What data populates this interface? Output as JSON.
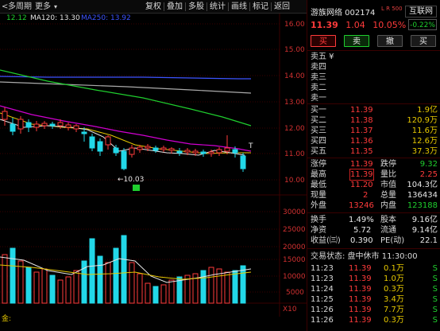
{
  "toolbar": {
    "left_items": [
      "多周期",
      "更多"
    ],
    "right_items": [
      "复权",
      "叠加",
      "多股",
      "统计",
      "画线",
      "标记",
      "返回"
    ]
  },
  "ma_legend": [
    {
      "text": "12.12",
      "color": "#e6e6e6"
    },
    {
      "text": "MA120: 13.30",
      "color": "#e6e6e6"
    },
    {
      "text": "MA250: 13.92",
      "color": "#3c54ff"
    }
  ],
  "chart": {
    "price_axis": [
      "16.00",
      "15.00",
      "14.00",
      "13.00",
      "12.00",
      "11.00",
      "10.00"
    ],
    "volume_axis": [
      "30000",
      "25000",
      "20000",
      "15000",
      "10000",
      "5000"
    ],
    "volume_unit": "X10",
    "min_marker": "←10.03",
    "fund_label": "金:",
    "colors": {
      "up": "#ff3b3b",
      "down": "#22d8e8",
      "ma5": "#e6e6e6",
      "ma10": "#e6c800",
      "ma20": "#d000d0",
      "ma60": "#1fcf2e",
      "ma120": "#aaaaaa",
      "ma250": "#3c54ff"
    }
  },
  "panel": {
    "title": "游族网络 002174",
    "badge": "L R 500",
    "link": "互联网",
    "price": "11.39",
    "change": "1.04",
    "change_pct": "10.05%",
    "side_pct": "-0.22%",
    "buttons": [
      "买",
      "卖",
      "撤",
      "买"
    ],
    "sell_rows": [
      {
        "label": "卖五 ¥",
        "price": "",
        "vol": ""
      },
      {
        "label": "卖四",
        "price": "",
        "vol": ""
      },
      {
        "label": "卖三",
        "price": "",
        "vol": ""
      },
      {
        "label": "卖二",
        "price": "",
        "vol": ""
      },
      {
        "label": "卖一",
        "price": "",
        "vol": ""
      }
    ],
    "buy_rows": [
      {
        "label": "买一",
        "price": "11.39",
        "vol": "1.9亿"
      },
      {
        "label": "买二",
        "price": "11.38",
        "vol": "120.9万"
      },
      {
        "label": "买三",
        "price": "11.37",
        "vol": "11.6万"
      },
      {
        "label": "买四",
        "price": "11.36",
        "vol": "12.6万"
      },
      {
        "label": "买五",
        "price": "11.35",
        "vol": "37.3万"
      }
    ],
    "stats": [
      {
        "l1": "涨停",
        "v1": "11.39",
        "c1": "red",
        "l2": "跌停",
        "v2": "9.32",
        "c2": "grn"
      },
      {
        "l1": "最高",
        "v1": "11.39",
        "c1": "red",
        "l2": "量比",
        "v2": "2.25",
        "c2": "red"
      },
      {
        "l1": "最低",
        "v1": "11.20",
        "c1": "red",
        "l2": "市值",
        "v2": "104.3亿",
        "c2": "wht"
      },
      {
        "l1": "现量",
        "v1": "2",
        "c1": "red",
        "l2": "总量",
        "v2": "136434",
        "c2": "wht"
      },
      {
        "l1": "外盘",
        "v1": "13246",
        "c1": "red",
        "l2": "内盘",
        "v2": "123188",
        "c2": "grn"
      }
    ],
    "stats2": [
      {
        "l1": "换手",
        "v1": "1.49%",
        "l2": "股本",
        "v2": "9.16亿"
      },
      {
        "l1": "净资",
        "v1": "5.72",
        "l2": "流通",
        "v2": "9.14亿"
      },
      {
        "l1": "收益(㈢)",
        "v1": "0.390",
        "l2": "PE(动)",
        "v2": "22.1"
      }
    ],
    "trade_status": "交易状态: 盘中休市 11:30:00",
    "trades": [
      {
        "time": "11:23",
        "price": "11.39",
        "vol": "0.1万",
        "dir": "S"
      },
      {
        "time": "11:23",
        "price": "11.39",
        "vol": "1.0万",
        "dir": "S"
      },
      {
        "time": "11:24",
        "price": "11.39",
        "vol": "0.3万",
        "dir": "S"
      },
      {
        "time": "11:25",
        "price": "11.39",
        "vol": "3.4万",
        "dir": "S"
      },
      {
        "time": "11:26",
        "price": "11.39",
        "vol": "7.7万",
        "dir": "S"
      },
      {
        "time": "11:26",
        "price": "11.39",
        "vol": "0.3万",
        "dir": "S"
      }
    ]
  }
}
